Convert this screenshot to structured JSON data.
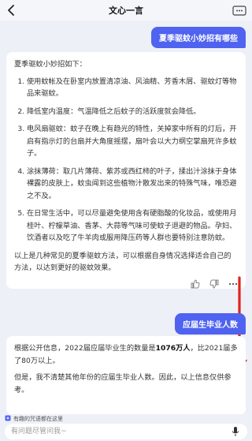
{
  "app": {
    "title": "文心一言"
  },
  "conversation": {
    "q1": "夏季驱蚊小妙招有哪些",
    "a1": {
      "intro": "夏季驱蚊小妙招如下：",
      "items": [
        "使用蚊帐及在卧室内放置清凉油、风油精、芳香木屑、驱蚊灯等物品来驱蚊。",
        "降低室内温度：气温降低之后蚊子的活跃度就会降低。",
        "电风扇驱蚊：蚊子在晚上有趋光的特性，关掉家中所有的灯后，开启有指示灯的台扇并大角度摇摆，扇叶会以大力纲空掌扇死许多蚊子。",
        "涂抹薄荷：取几片薄荷、紫苏或西红柿的叶子，揉出汁涂抹于身体裸露的皮肤上，蚊虫闻到这些植物汁散发出来的特殊气味，唯恐避之不及。",
        "在日常生活中，可以尽量避免使用含有硬脂酸的化妆品，或使用月桂叶、柠檬草油、香茅、大蒜等气味可使蚊子退避的物品。孕妇、饮酒者以及吃了牛羊肉或服用降压药等人群也要特别注意防蚊。"
      ],
      "outro": "以上是几种常见的夏季驱蚊方法，可以根据自身情况选择适合自己的方法，以达到更好的驱蚊效果。"
    },
    "q2": "应届生毕业人数",
    "a2": {
      "line1_before": "根据公开信息，2022届应届毕业生的数量是",
      "line1_bold": "1076万人",
      "line1_after": "，比2021届多了80万以上。",
      "line2": "但是，我不清楚其他年份的应届生毕业人数。因此，以上信息仅供参考。"
    }
  },
  "suggestion": {
    "text": "有趣的咒语都在这里",
    "icon": "sparkle-icon"
  },
  "input": {
    "placeholder": "有问题尽管问我~",
    "icon": "microphone-icon"
  },
  "annotation": {
    "color": "#e0241b"
  }
}
